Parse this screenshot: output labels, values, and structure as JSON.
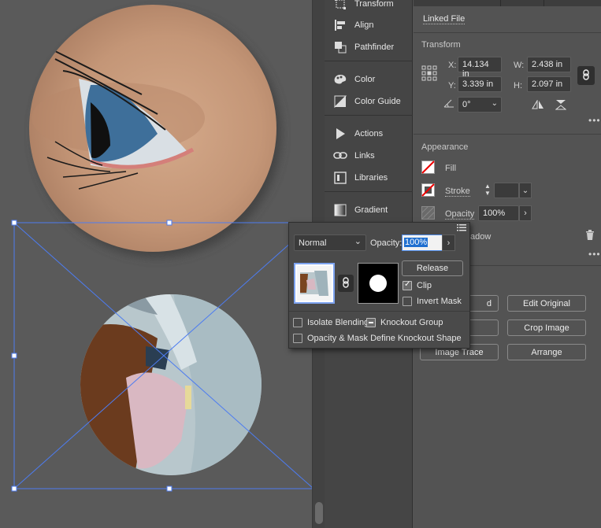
{
  "dock": {
    "items": [
      {
        "label": "Transform",
        "icon": "transform-icon"
      },
      {
        "label": "Align",
        "icon": "align-icon"
      },
      {
        "label": "Pathfinder",
        "icon": "pathfinder-icon"
      },
      {
        "label": "Color",
        "icon": "color-palette-icon"
      },
      {
        "label": "Color Guide",
        "icon": "color-guide-icon"
      },
      {
        "label": "Actions",
        "icon": "play-icon"
      },
      {
        "label": "Links",
        "icon": "link-icon"
      },
      {
        "label": "Libraries",
        "icon": "libraries-icon"
      },
      {
        "label": "Gradient",
        "icon": "gradient-icon"
      }
    ]
  },
  "properties": {
    "linked_file": "Linked File",
    "transform": {
      "title": "Transform",
      "x_label": "X:",
      "x_value": "14.134 in",
      "y_label": "Y:",
      "y_value": "3.339 in",
      "w_label": "W:",
      "w_value": "2.438 in",
      "h_label": "H:",
      "h_value": "2.097 in",
      "rotate_value": "0°"
    },
    "appearance": {
      "title": "Appearance",
      "fill_label": "Fill",
      "stroke_label": "Stroke",
      "opacity_label": "Opacity",
      "opacity_value": "100%",
      "shadow_fragment": "adow"
    },
    "buttons": {
      "edit_original": "Edit Original",
      "crop_image": "Crop Image",
      "image_trace": "Image Trace",
      "arrange": "Arrange",
      "embed_fragment": "d"
    }
  },
  "transparency_popup": {
    "blend_mode": "Normal",
    "opacity_label": "Opacity:",
    "opacity_value": "100%",
    "release_label": "Release",
    "clip_label": "Clip",
    "clip_checked": true,
    "invert_mask_label": "Invert Mask",
    "invert_mask_checked": false,
    "isolate_blending_label": "Isolate Blending",
    "knockout_group_label": "Knockout Group",
    "opacity_mask_label": "Opacity & Mask Define Knockout Shape"
  },
  "colors": {
    "selection": "#4d7cf0",
    "panel_bg": "#535353",
    "dock_bg": "#454545",
    "highlight": "#1f6fd0"
  }
}
